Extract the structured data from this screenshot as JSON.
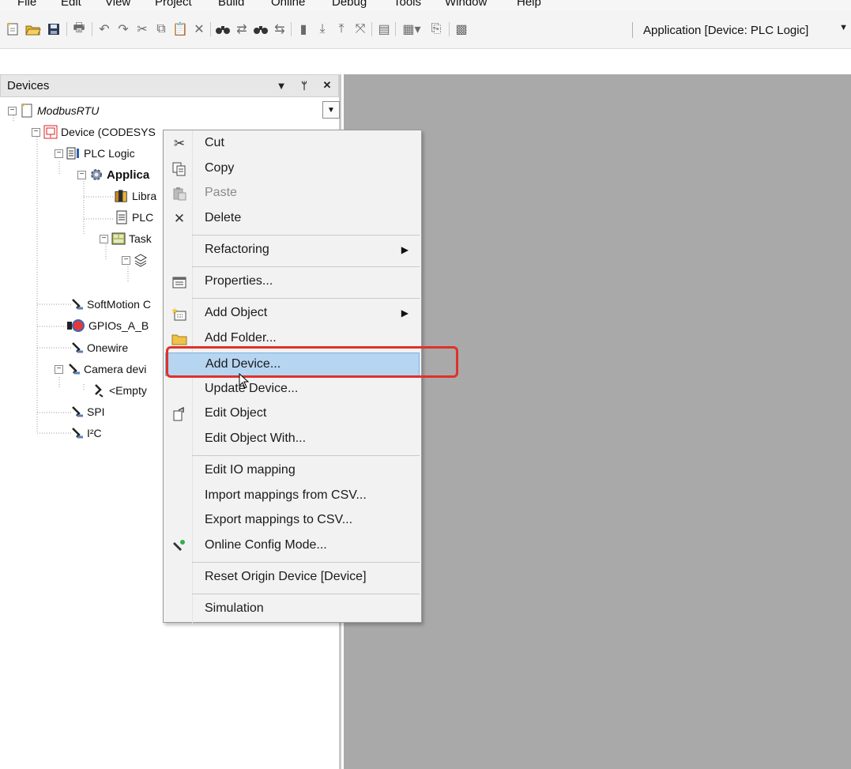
{
  "menubar": {
    "items": [
      "File",
      "Edit",
      "View",
      "Project",
      "Build",
      "Online",
      "Debug",
      "Tools",
      "Window",
      "Help"
    ]
  },
  "toolbar": {
    "active_application": "Application [Device: PLC Logic]"
  },
  "devices_panel": {
    "title": "Devices",
    "tree": {
      "root": "ModbusRTU",
      "device": "Device (CODESYS",
      "plc_logic": "PLC Logic",
      "application": "Applica",
      "library": "Libra",
      "plc_prg": "PLC",
      "task": "Task",
      "softmotion": "SoftMotion C",
      "gpios": "GPIOs_A_B",
      "onewire": "Onewire",
      "camera": "Camera devi",
      "empty": "<Empty",
      "spi": "SPI",
      "i2c": "I²C"
    }
  },
  "context_menu": {
    "items": [
      {
        "label": "Cut",
        "icon": "scissors-icon"
      },
      {
        "label": "Copy",
        "icon": "copy-icon"
      },
      {
        "label": "Paste",
        "icon": "paste-icon",
        "disabled": true
      },
      {
        "label": "Delete",
        "icon": "delete-x-icon"
      },
      {
        "label": "Refactoring",
        "submenu": true
      },
      {
        "label": "Properties...",
        "icon": "properties-icon"
      },
      {
        "label": "Add Object",
        "icon": "add-object-icon",
        "submenu": true
      },
      {
        "label": "Add Folder...",
        "icon": "folder-icon"
      },
      {
        "label": "Add Device...",
        "highlighted": true
      },
      {
        "label": "Update Device..."
      },
      {
        "label": "Edit Object",
        "icon": "edit-object-icon"
      },
      {
        "label": "Edit Object With..."
      },
      {
        "label": "Edit IO mapping"
      },
      {
        "label": "Import mappings from CSV..."
      },
      {
        "label": "Export mappings to CSV..."
      },
      {
        "label": "Online Config Mode...",
        "icon": "wrench-icon"
      },
      {
        "label": "Reset Origin Device [Device]"
      },
      {
        "label": "Simulation"
      }
    ]
  },
  "colors": {
    "highlight_border": "#e0312b",
    "menu_hover": "#b5d5f1",
    "editor_background": "#a9a9a9"
  }
}
